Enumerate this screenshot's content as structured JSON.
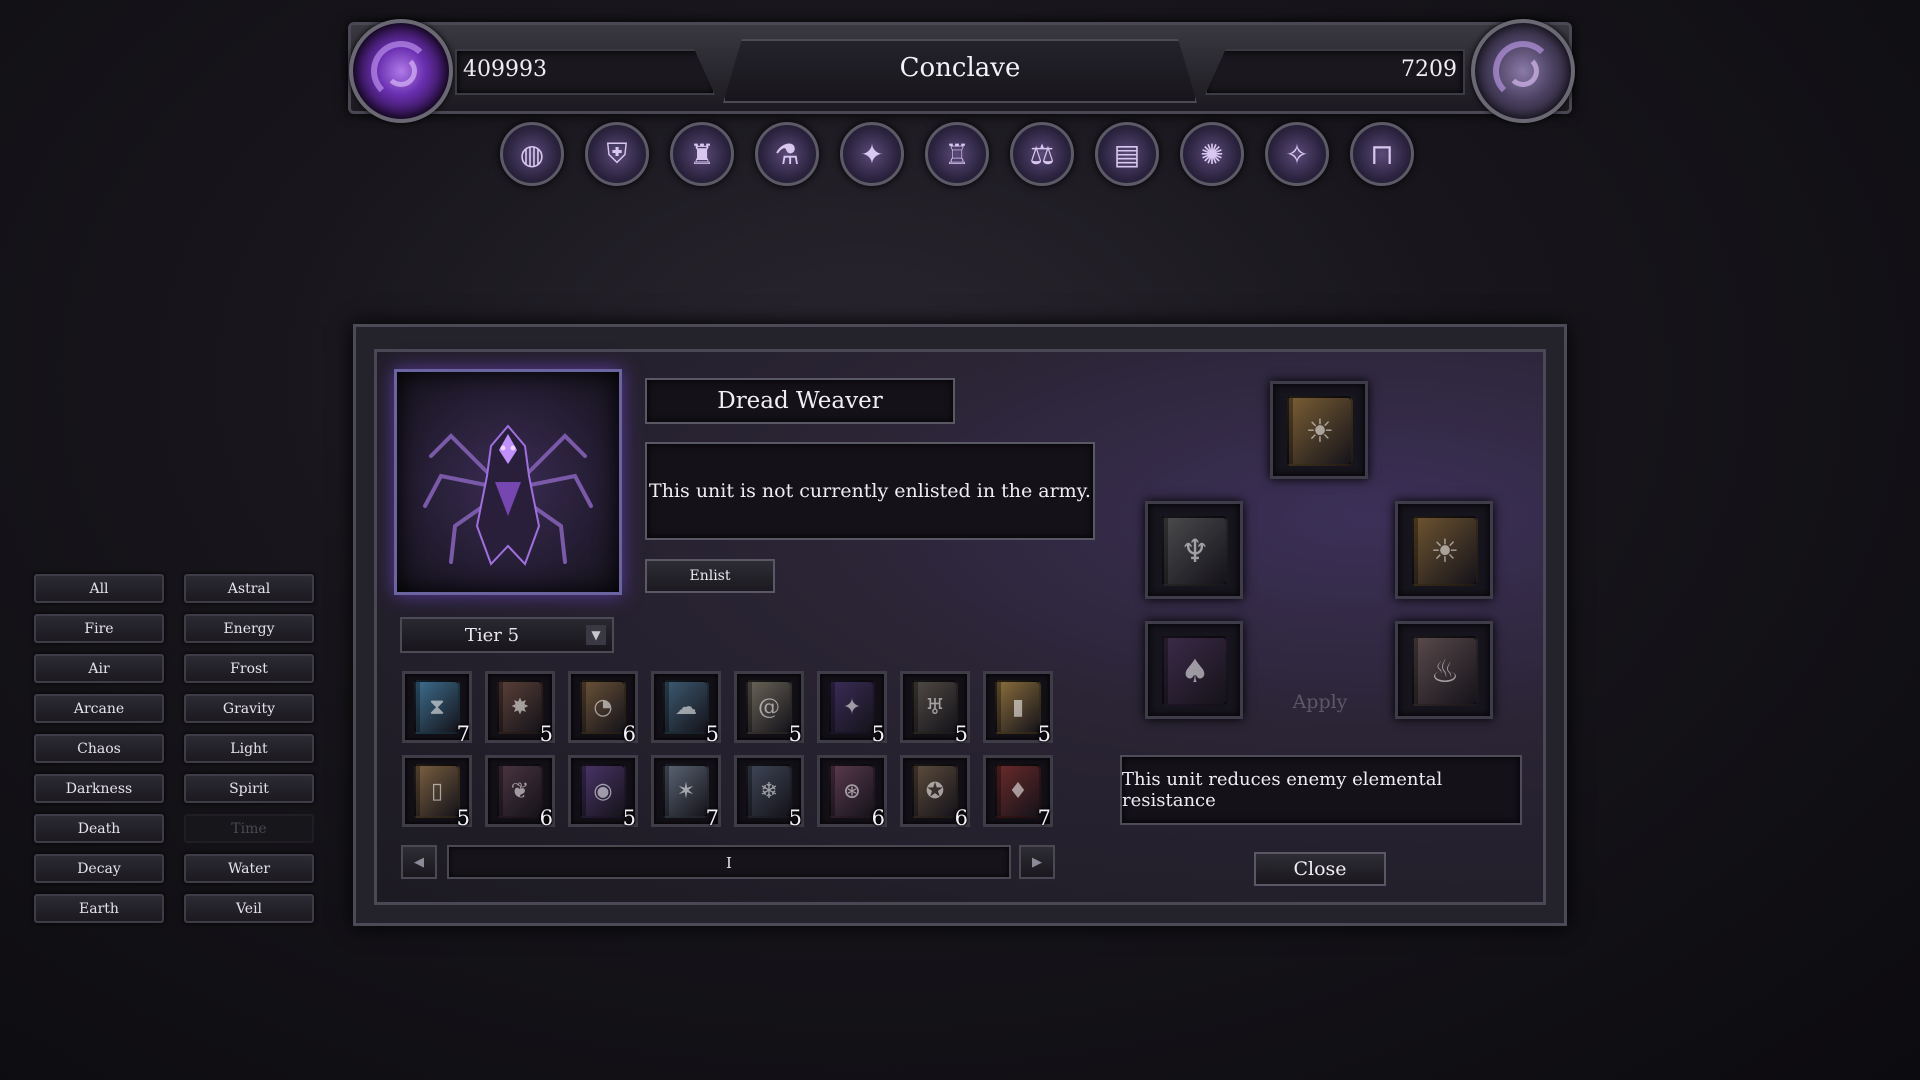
{
  "header": {
    "gold_value": "409993",
    "title": "Conclave",
    "mana_value": "7209"
  },
  "nav": [
    {
      "icon": "world-map-icon",
      "glyph": "◍"
    },
    {
      "icon": "heraldry-shield-icon",
      "glyph": "⛨"
    },
    {
      "icon": "dark-tower-icon",
      "glyph": "♜"
    },
    {
      "icon": "alchemy-flask-icon",
      "glyph": "⚗"
    },
    {
      "icon": "spell-altar-icon",
      "glyph": "✦"
    },
    {
      "icon": "castle-spires-icon",
      "glyph": "♖"
    },
    {
      "icon": "scales-coins-icon",
      "glyph": "⚖"
    },
    {
      "icon": "tome-icon",
      "glyph": "▤"
    },
    {
      "icon": "arcane-sigil-icon",
      "glyph": "✺"
    },
    {
      "icon": "compass-star-icon",
      "glyph": "✧"
    },
    {
      "icon": "gate-door-icon",
      "glyph": "⊓"
    }
  ],
  "filters": [
    {
      "label": "All",
      "enabled": true
    },
    {
      "label": "Astral",
      "enabled": true
    },
    {
      "label": "Fire",
      "enabled": true
    },
    {
      "label": "Energy",
      "enabled": true
    },
    {
      "label": "Air",
      "enabled": true
    },
    {
      "label": "Frost",
      "enabled": true
    },
    {
      "label": "Arcane",
      "enabled": true
    },
    {
      "label": "Gravity",
      "enabled": true
    },
    {
      "label": "Chaos",
      "enabled": true
    },
    {
      "label": "Light",
      "enabled": true
    },
    {
      "label": "Darkness",
      "enabled": true
    },
    {
      "label": "Spirit",
      "enabled": true
    },
    {
      "label": "Death",
      "enabled": true
    },
    {
      "label": "Time",
      "enabled": false
    },
    {
      "label": "Decay",
      "enabled": true
    },
    {
      "label": "Water",
      "enabled": true
    },
    {
      "label": "Earth",
      "enabled": true
    },
    {
      "label": "Veil",
      "enabled": true
    }
  ],
  "unit": {
    "name": "Dread Weaver",
    "status": "This unit is not currently enlisted in the army.",
    "enlist_label": "Enlist",
    "portrait_icon": "spider-knight-icon",
    "tier": "Tier 5"
  },
  "books": [
    {
      "icon": "hourglass-tome-icon",
      "glyph": "⧗",
      "color": "#3d6e8e",
      "count": "7"
    },
    {
      "icon": "fire-tome-icon",
      "glyph": "✸",
      "color": "#5a4038",
      "count": "5"
    },
    {
      "icon": "ear-tome-icon",
      "glyph": "◔",
      "color": "#6a5238",
      "count": "6"
    },
    {
      "icon": "cloud-tome-icon",
      "glyph": "☁",
      "color": "#3c5a70",
      "count": "5"
    },
    {
      "icon": "vortex-tome-icon",
      "glyph": "@",
      "color": "#6a6458",
      "count": "5"
    },
    {
      "icon": "void-tome-icon",
      "glyph": "✦",
      "color": "#3a2c58",
      "count": "5"
    },
    {
      "icon": "chalice-tome-icon",
      "glyph": "♅",
      "color": "#504a44",
      "count": "5"
    },
    {
      "icon": "light-tome-icon",
      "glyph": "▮",
      "color": "#8a6e3c",
      "count": "5"
    },
    {
      "icon": "parchment-tome-icon",
      "glyph": "▯",
      "color": "#7a6040",
      "count": "5"
    },
    {
      "icon": "crimson-tome-icon",
      "glyph": "❦",
      "color": "#4a3440",
      "count": "6"
    },
    {
      "icon": "arcane-swirl-tome-icon",
      "glyph": "◉",
      "color": "#4a3468",
      "count": "5"
    },
    {
      "icon": "star-tome-icon",
      "glyph": "✶",
      "color": "#5a6474",
      "count": "7"
    },
    {
      "icon": "frost-tome-icon",
      "glyph": "❄",
      "color": "#3e4656",
      "count": "5"
    },
    {
      "icon": "gravity-tome-icon",
      "glyph": "⊛",
      "color": "#5a3a4e",
      "count": "6"
    },
    {
      "icon": "seal-tome-icon",
      "glyph": "✪",
      "color": "#5c4c3c",
      "count": "6"
    },
    {
      "icon": "blood-tome-icon",
      "glyph": "♦",
      "color": "#6a2a2a",
      "count": "7"
    }
  ],
  "pager": {
    "page": "I"
  },
  "equipment": [
    {
      "icon": "sun-tome-icon",
      "glyph": "☀",
      "color": "#7a5e34"
    },
    {
      "icon": "spirit-tome-icon",
      "glyph": "♆",
      "color": "#4a4a4c"
    },
    {
      "icon": "eclipse-tome-icon",
      "glyph": "☀",
      "color": "#6e5430"
    },
    {
      "icon": "shadow-tome-icon",
      "glyph": "♠",
      "color": "#3c2a48"
    },
    {
      "icon": "smoke-tome-icon",
      "glyph": "♨",
      "color": "#5a4a4c"
    }
  ],
  "apply_label": "Apply",
  "effect_text": "This unit reduces enemy elemental resistance",
  "close_label": "Close"
}
